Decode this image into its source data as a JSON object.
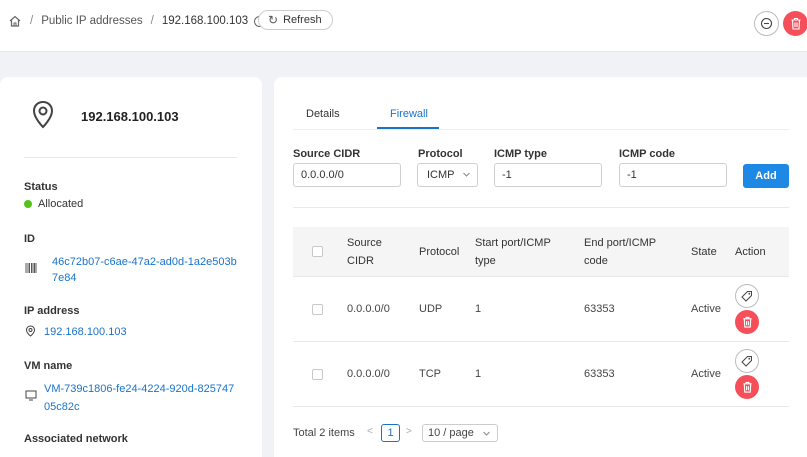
{
  "breadcrumb": {
    "home_icon": "home-icon",
    "section": "Public IP addresses",
    "current": "192.168.100.103"
  },
  "toolbar": {
    "refresh_label": "Refresh"
  },
  "colors": {
    "accent": "#1a73c8",
    "danger": "#f5505a",
    "success": "#52c41a",
    "primary_button": "#1e88e5"
  },
  "summary": {
    "title": "192.168.100.103",
    "status_label": "Status",
    "status_value": "Allocated",
    "id_label": "ID",
    "id_value_line1": "46c72b07-c6ae-47a2-ad0d-1a2e503b",
    "id_value_line2": "7e84",
    "ip_label": "IP address",
    "ip_value": "192.168.100.103",
    "vm_label": "VM name",
    "vm_value_line1": "VM-739c1806-fe24-4224-920d-825747",
    "vm_value_line2": "05c82c",
    "network_label": "Associated network"
  },
  "tabs": [
    {
      "label": "Details",
      "active": false
    },
    {
      "label": "Firewall",
      "active": true
    }
  ],
  "form": {
    "source_cidr_label": "Source CIDR",
    "source_cidr_value": "0.0.0.0/0",
    "protocol_label": "Protocol",
    "protocol_value": "ICMP",
    "icmp_type_label": "ICMP type",
    "icmp_type_value": "-1",
    "icmp_code_label": "ICMP code",
    "icmp_code_value": "-1",
    "add_label": "Add"
  },
  "table": {
    "headers": {
      "source_cidr_1": "Source",
      "source_cidr_2": "CIDR",
      "protocol": "Protocol",
      "start_1": "Start port/ICMP",
      "start_2": "type",
      "end_1": "End port/ICMP",
      "end_2": "code",
      "state": "State",
      "action": "Action"
    },
    "rows": [
      {
        "source_cidr": "0.0.0.0/0",
        "protocol": "UDP",
        "start": "1",
        "end": "63353",
        "state": "Active"
      },
      {
        "source_cidr": "0.0.0.0/0",
        "protocol": "TCP",
        "start": "1",
        "end": "63353",
        "state": "Active"
      }
    ]
  },
  "pagination": {
    "total": "Total 2 items",
    "current_page": "1",
    "page_size": "10 / page"
  }
}
